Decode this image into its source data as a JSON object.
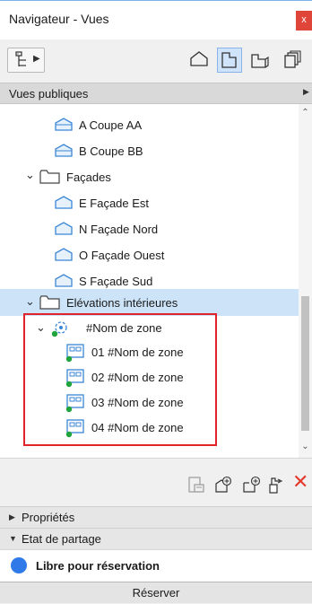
{
  "window": {
    "title": "Navigateur - Vues",
    "close_glyph": "x"
  },
  "toolbar": {
    "map_icon": "project-map-icon",
    "views": [
      {
        "name": "house-icon",
        "selected": false
      },
      {
        "name": "floor-plan-icon",
        "selected": true
      },
      {
        "name": "section-sheet-icon",
        "selected": false
      },
      {
        "name": "layout-stack-icon",
        "selected": false
      }
    ]
  },
  "section": {
    "title": "Vues publiques"
  },
  "tree": {
    "sections": [
      {
        "label": "A Coupe AA"
      },
      {
        "label": "B Coupe BB"
      }
    ],
    "facades_folder": "Façades",
    "facades": [
      {
        "label": "E Façade Est"
      },
      {
        "label": "N Façade Nord"
      },
      {
        "label": "O Façade Ouest"
      },
      {
        "label": "S Façade Sud"
      }
    ],
    "interior_folder": "Elévations intérieures",
    "zone_group": "#Nom de zone",
    "zones": [
      {
        "label": "01 #Nom de zone"
      },
      {
        "label": "02 #Nom de zone"
      },
      {
        "label": "03 #Nom de zone"
      },
      {
        "label": "04 #Nom de zone"
      }
    ]
  },
  "actions": {
    "icons": [
      "view-settings-icon",
      "new-view-icon",
      "new-folder-icon",
      "clone-view-icon",
      "delete-icon"
    ],
    "delete_glyph": "✕"
  },
  "panels": {
    "properties": "Propriétés",
    "sharing": "Etat de partage",
    "status": "Libre pour réservation",
    "reserve": "Réserver"
  },
  "colors": {
    "accent": "#2f7ae8",
    "selection": "#cce3f8",
    "highlight_border": "#e3232b",
    "icon_blue": "#3a86d6",
    "status_green": "#21a33d"
  }
}
